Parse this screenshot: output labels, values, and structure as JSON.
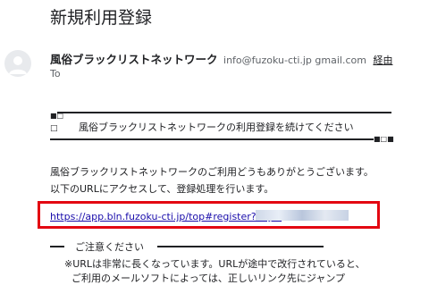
{
  "email": {
    "subject": "新規利用登録",
    "sender": {
      "name": "風俗ブラックリストネットワーク",
      "email": "info@fuzoku-cti.jp gmail.com",
      "via": "経由"
    },
    "to_label": "To",
    "banner": {
      "top_marker": "■□",
      "bullet": "□",
      "text": "風俗ブラックリストネットワークの利用登録を続けてください",
      "bottom_marker": "■□■"
    },
    "greeting": "風俗ブラックリストネットワークのご利用どうもありがとうございます。",
    "instruction": "以下のURLにアクセスして、登録処理を行います。",
    "register_link": "https://app.bln.fuzoku-cti.jp/top#register?key=",
    "notes": {
      "heading": "ご注意ください",
      "line1": "※URLは非常に長くなっています。URLが途中で改行されていると、",
      "line2": "ご利用のメールソフトによっては、正しいリンク先にジャンプ"
    }
  }
}
